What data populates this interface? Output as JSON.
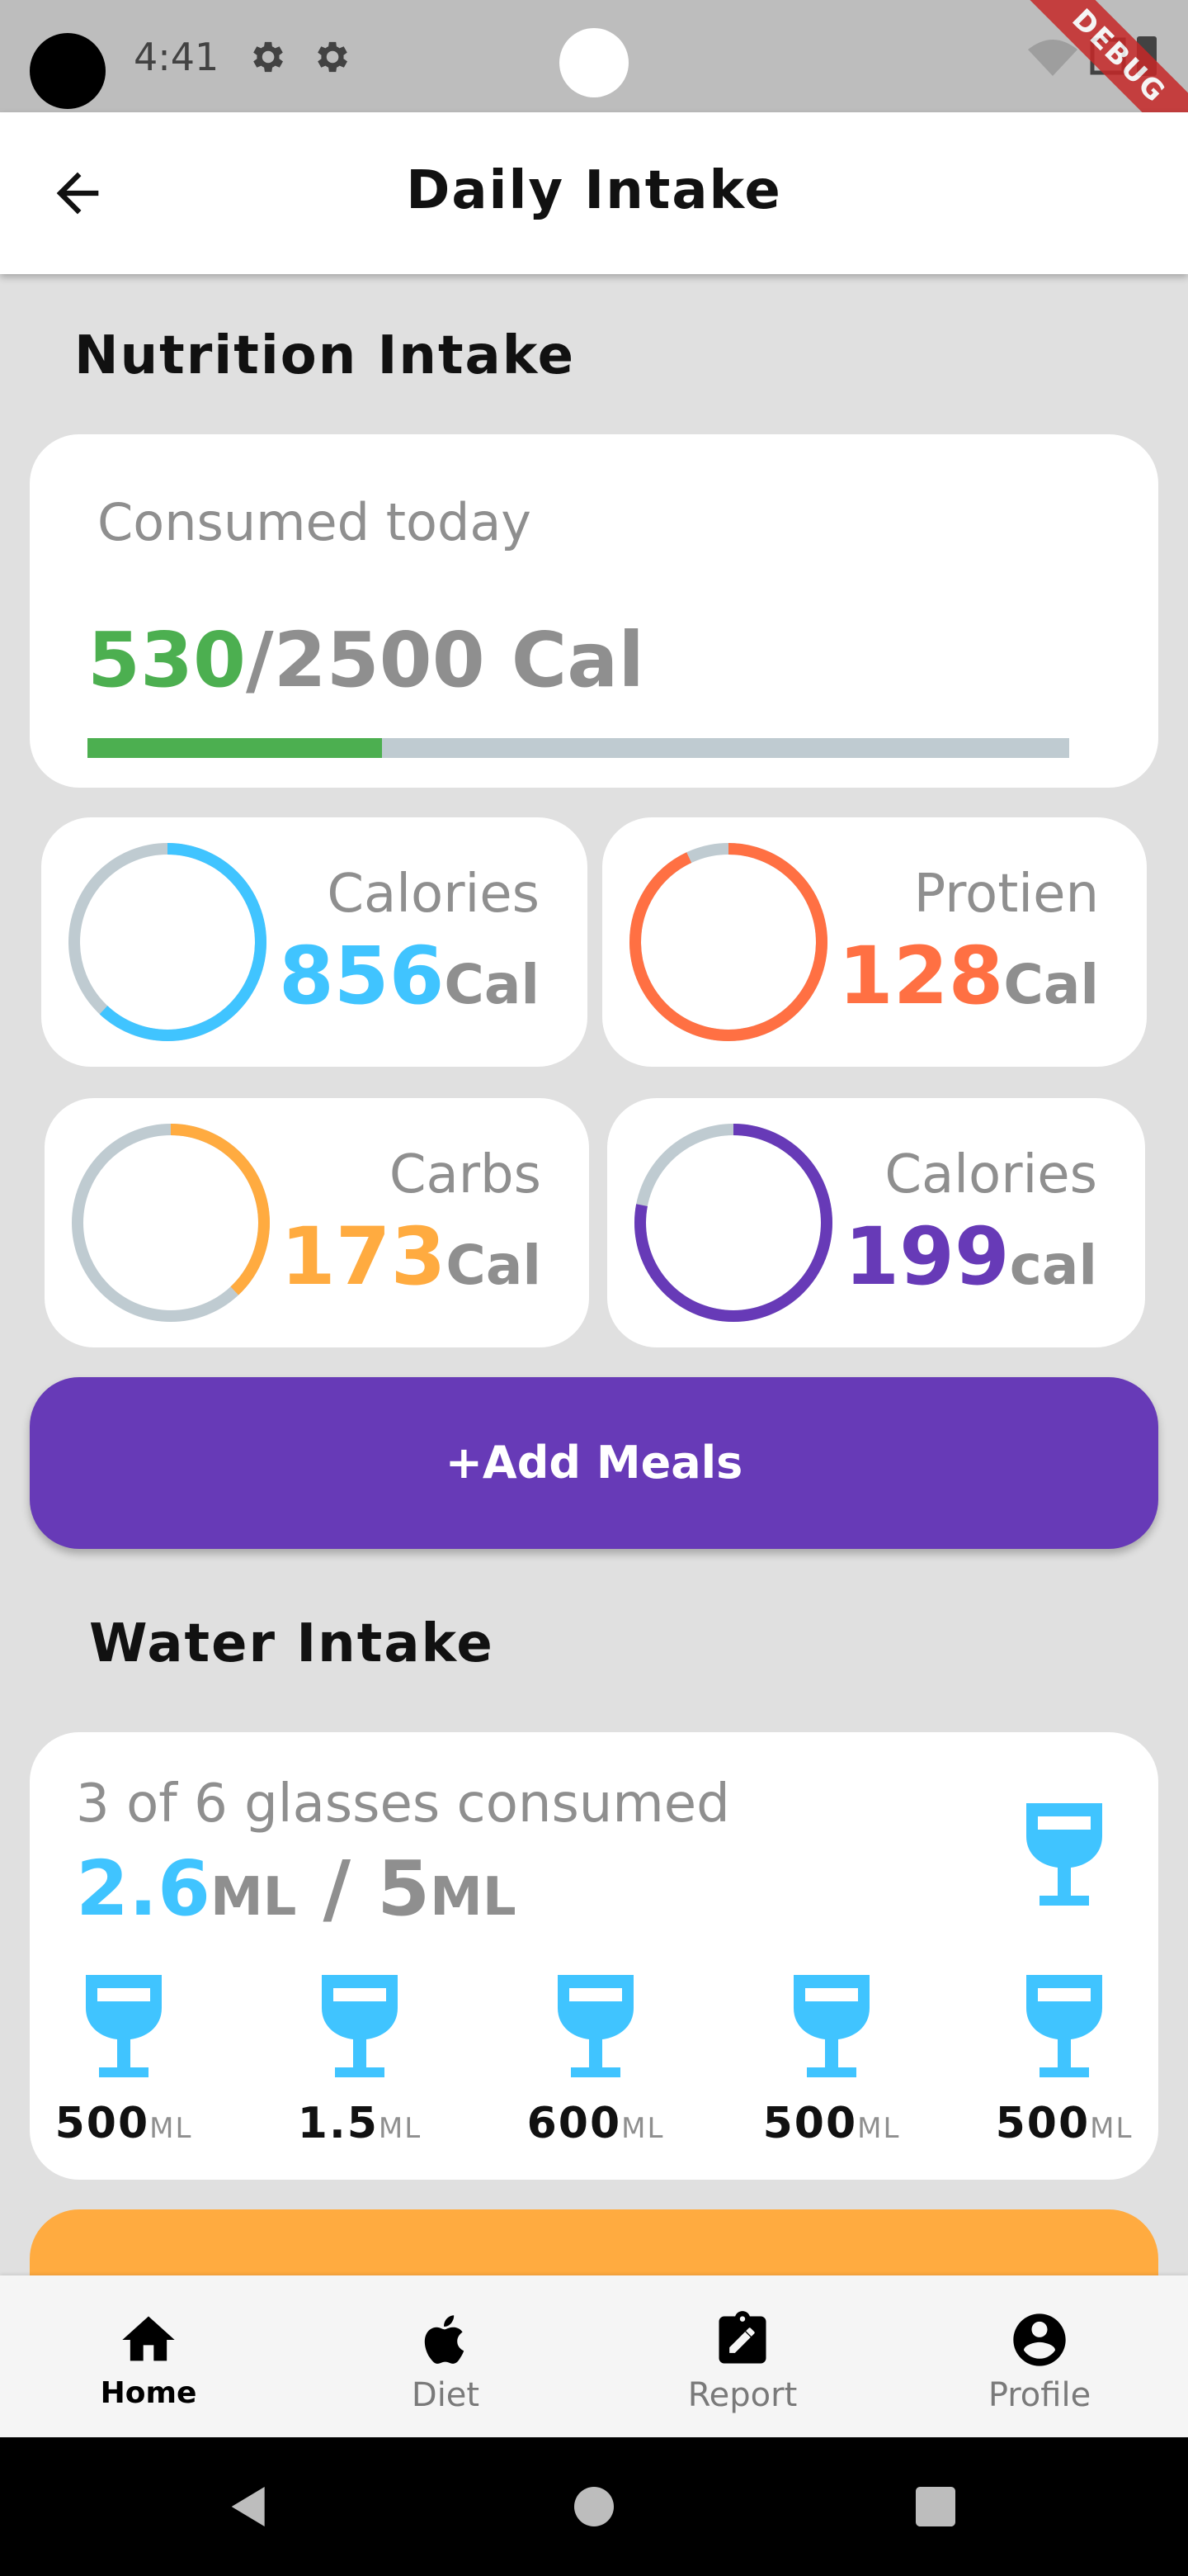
{
  "status_bar": {
    "time": "4:41",
    "debug_banner": "DEBUG",
    "icons": [
      "settings-icon",
      "settings-icon",
      "wifi-icon",
      "signal-icon",
      "battery-icon"
    ]
  },
  "app_bar": {
    "title": "Daily Intake",
    "back_icon": "arrow-back-icon"
  },
  "nutrition": {
    "section_title": "Nutrition Intake",
    "summary": {
      "label": "Consumed today",
      "consumed": "530",
      "total": "/2500 Cal",
      "progress_fraction": 0.3
    },
    "stats": [
      {
        "label": "Calories",
        "value": "856",
        "unit": "Cal",
        "color": "#40c4ff",
        "progress": 0.62
      },
      {
        "label": "Protien",
        "value": "128",
        "unit": "Cal",
        "color": "#ff7043",
        "progress": 0.93
      },
      {
        "label": "Carbs",
        "value": "173",
        "unit": "Cal",
        "color": "#ffab40",
        "progress": 0.38
      },
      {
        "label": "Calories",
        "value": "199",
        "unit": "cal",
        "color": "#673ab7",
        "progress": 0.78
      }
    ]
  },
  "add_meals_button": "+Add Meals",
  "water": {
    "section_title": "Water Intake",
    "glasses_label": "3 of 6 glasses consumed",
    "consumed_amount": "2.6",
    "consumed_unit": "ML",
    "separator": " / ",
    "goal_amount": "5",
    "goal_unit": "ML",
    "glasses": [
      {
        "amount": "500",
        "unit": "ML"
      },
      {
        "amount": "1.5",
        "unit": "ML"
      },
      {
        "amount": "600",
        "unit": "ML"
      },
      {
        "amount": "500",
        "unit": "ML"
      },
      {
        "amount": "500",
        "unit": "ML"
      }
    ]
  },
  "bottom_nav": {
    "items": [
      {
        "label": "Home",
        "icon": "home-icon",
        "active": true
      },
      {
        "label": "Diet",
        "icon": "apple-icon",
        "active": false
      },
      {
        "label": "Report",
        "icon": "clipboard-edit-icon",
        "active": false
      },
      {
        "label": "Profile",
        "icon": "account-circle-icon",
        "active": false
      }
    ]
  },
  "colors": {
    "accent_purple": "#673ab7",
    "green": "#4caf50",
    "water_blue": "#40c4ff",
    "orange": "#ffab40"
  }
}
